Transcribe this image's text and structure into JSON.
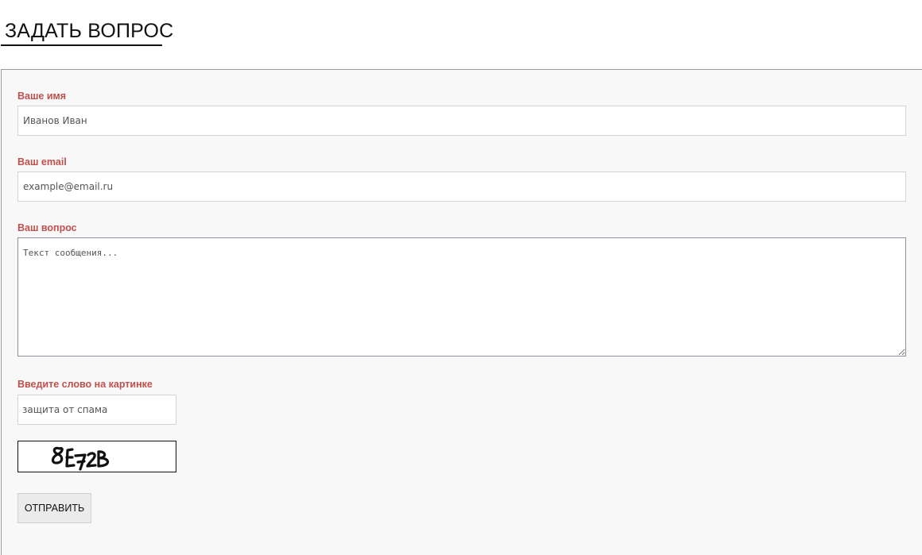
{
  "page": {
    "title": "ЗАДАТЬ ВОПРОС"
  },
  "form": {
    "name": {
      "label": "Ваше имя",
      "placeholder": "Иванов Иван"
    },
    "email": {
      "label": "Ваш email",
      "placeholder": "example@email.ru"
    },
    "question": {
      "label": "Ваш вопрос",
      "placeholder": "Текст сообщения..."
    },
    "captcha": {
      "label": "Введите слово на картинке",
      "placeholder": "защита от спама",
      "image_text": "8E72B"
    },
    "submit_label": "ОТПРАВИТЬ"
  },
  "colors": {
    "label": "#c0504d",
    "panel_background": "#f8f8f8",
    "button_background": "#ebebeb"
  }
}
